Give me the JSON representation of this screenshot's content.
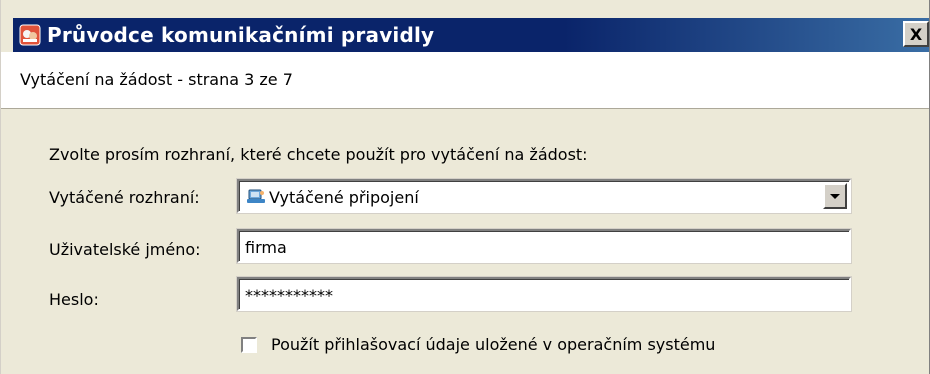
{
  "window": {
    "title": "Průvodce komunikačními pravidly",
    "close_label": "X"
  },
  "header": {
    "subtitle": "Vytáčení na žádost - strana 3 ze 7"
  },
  "form": {
    "instruction": "Zvolte prosím rozhraní, které chcete použít pro vytáčení na žádost:",
    "interface": {
      "label": "Vytáčené rozhraní:",
      "selected_value": "Vytáčené připojení",
      "icon": "dialup-connection-icon"
    },
    "username": {
      "label": "Uživatelské jméno:",
      "value": "firma"
    },
    "password": {
      "label": "Heslo:",
      "value": "***********"
    },
    "use_os_credentials": {
      "label": "Použít přihlašovací údaje uložené v operačním systému",
      "checked": false
    }
  },
  "colors": {
    "titlebar_start": "#0a246a",
    "titlebar_end": "#3a6ea5",
    "dialog_bg": "#ece9d8",
    "header_bg": "#ffffff"
  }
}
